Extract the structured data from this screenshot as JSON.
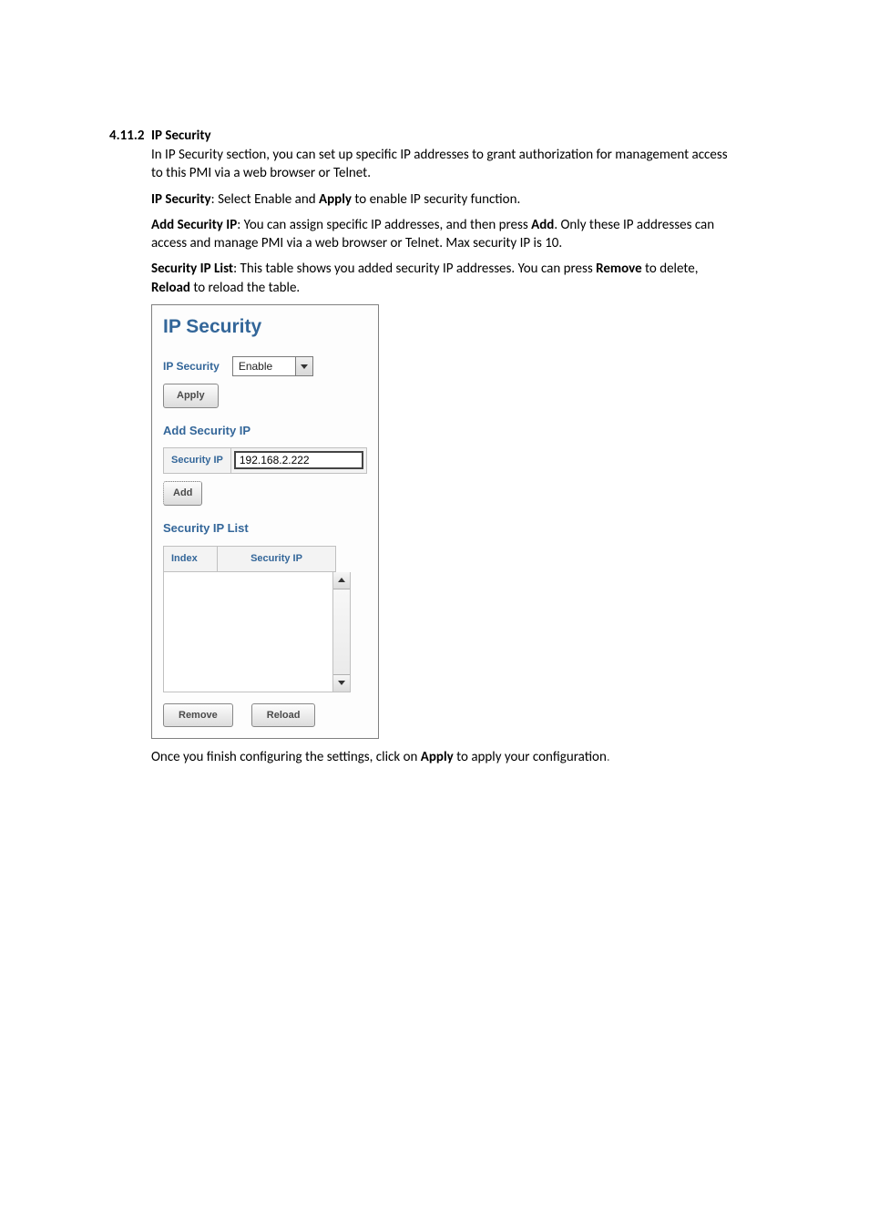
{
  "heading": {
    "number": "4.11.2",
    "title": "IP Security"
  },
  "paragraphs": {
    "intro": "In IP Security section, you can set up specific IP addresses to grant authorization for management access to this PMI via a web browser or Telnet.",
    "p2_label": "IP Security",
    "p2_text": ": Select Enable and ",
    "p2_bold2": "Apply",
    "p2_rest": " to enable IP security function.",
    "p3_label": "Add Security IP",
    "p3_text": ": You can assign specific IP addresses, and then press ",
    "p3_bold2": "Add",
    "p3_rest": ". Only these IP addresses can access and manage PMI via a web browser or Telnet. Max security IP is 10.",
    "p4_label": "Security IP List",
    "p4_text": ": This table shows you added security IP addresses. You can press ",
    "p4_bold2": "Remove",
    "p4_mid": " to delete, ",
    "p4_bold3": "Reload",
    "p4_rest": " to reload the table.",
    "after1": "Once you finish configuring the settings, click on ",
    "after_bold": "Apply",
    "after2": " to apply your configuration",
    "after_period": "."
  },
  "panel": {
    "title": "IP Security",
    "ip_security_label": "IP Security",
    "ip_security_value": "Enable",
    "apply_btn": "Apply",
    "add_heading": "Add Security IP",
    "add_row_label": "Security IP",
    "add_row_value": "192.168.2.222",
    "add_btn": "Add",
    "list_heading": "Security IP List",
    "th_index": "Index",
    "th_ip": "Security IP",
    "remove_btn": "Remove",
    "reload_btn": "Reload"
  }
}
